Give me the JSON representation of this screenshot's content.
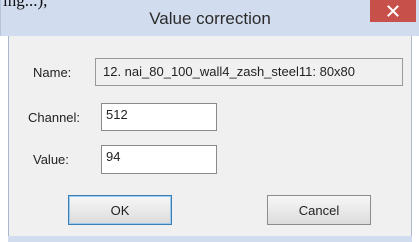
{
  "cropped_text": "ing...),",
  "dialog": {
    "title": "Value correction",
    "close_icon": "close-icon"
  },
  "fields": {
    "name_label": "Name:",
    "name_value": "12. nai_80_100_wall4_zash_steel11: 80x80",
    "channel_label": "Channel:",
    "channel_value": "512",
    "value_label": "Value:",
    "value_value": "94"
  },
  "buttons": {
    "ok": "OK",
    "cancel": "Cancel"
  },
  "colors": {
    "titlebar": "#d2dcef",
    "close_button": "#c7504a",
    "dialog_body": "#f0f0f0"
  }
}
